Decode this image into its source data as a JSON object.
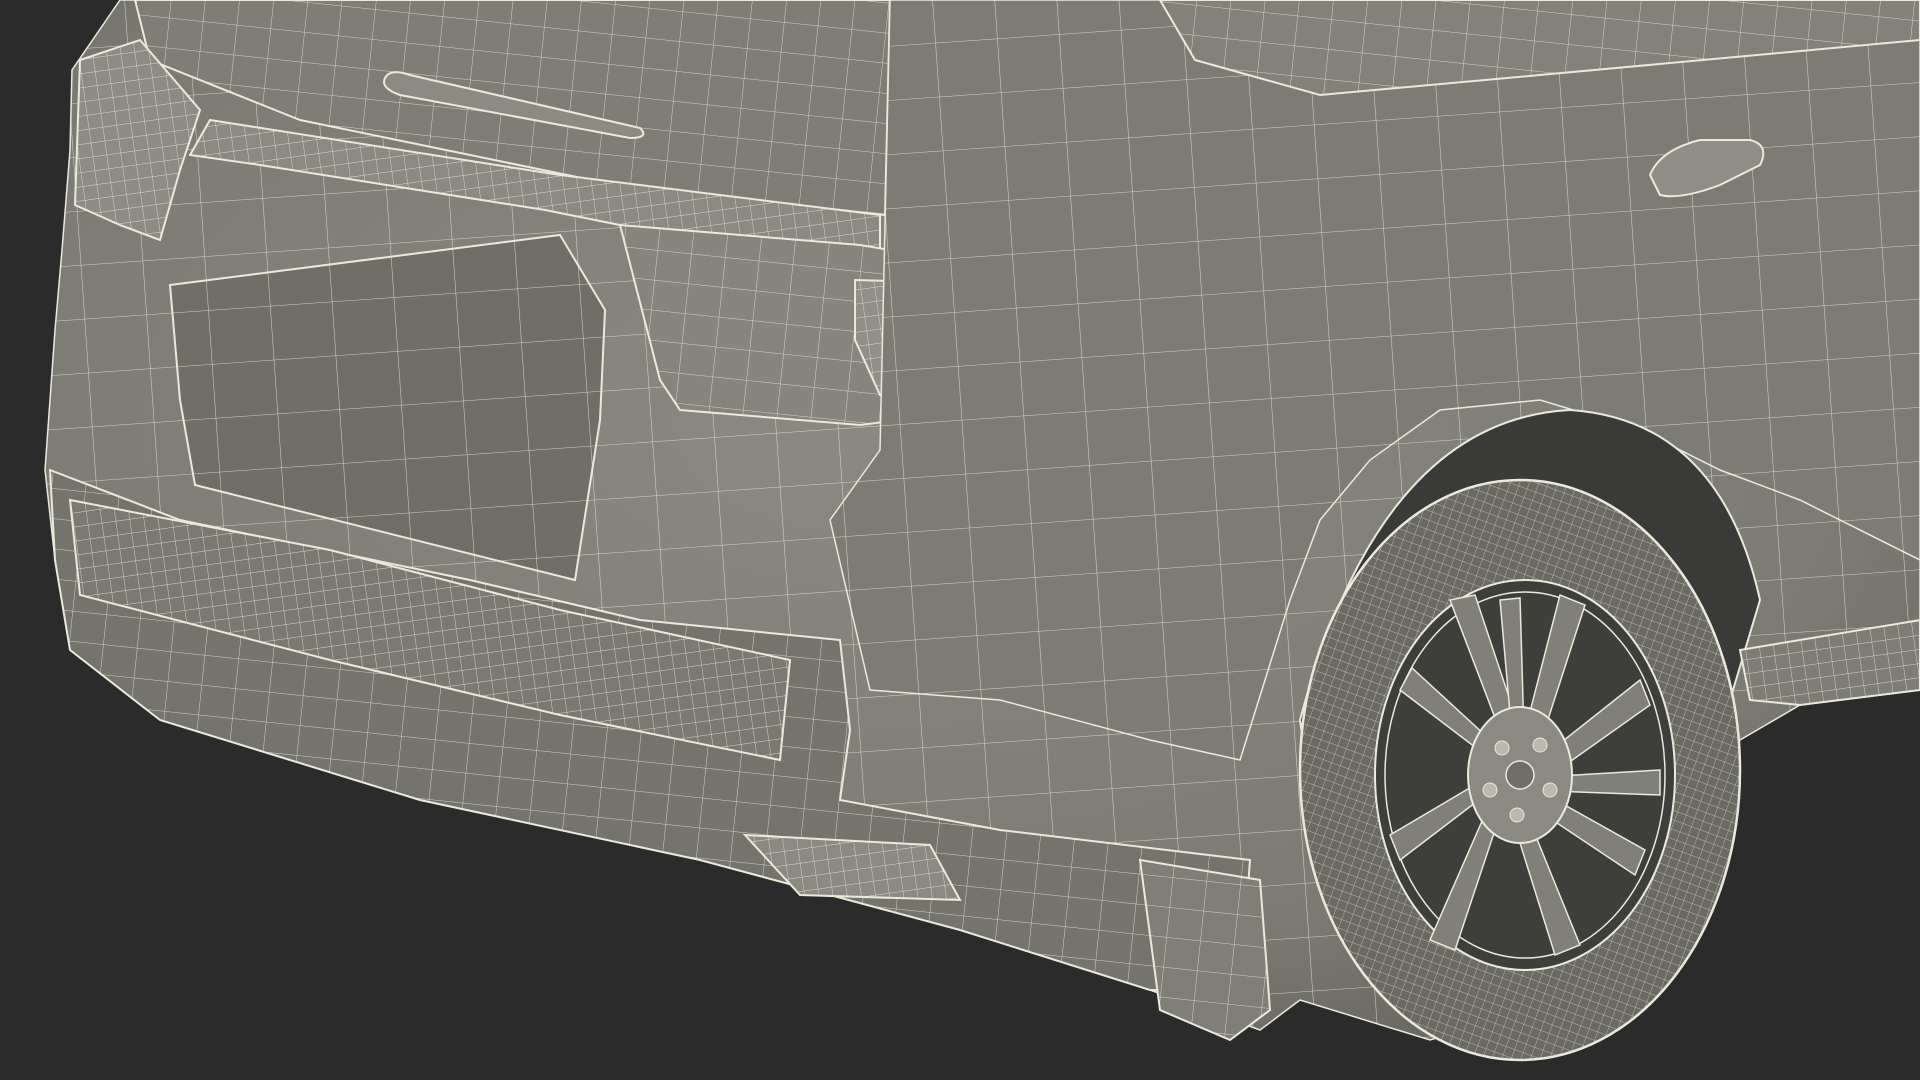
{
  "scene": {
    "subject": "wireframe-suv-rear",
    "colors": {
      "background": "#2b2b2b",
      "body": "#7b7b73",
      "body_light": "#8a8a82",
      "body_dark": "#5e5e57",
      "wire": "#e9e9dc",
      "tire": "#6a6a63",
      "wheel_well": "#3a3a38",
      "rim": "#807f78"
    }
  }
}
